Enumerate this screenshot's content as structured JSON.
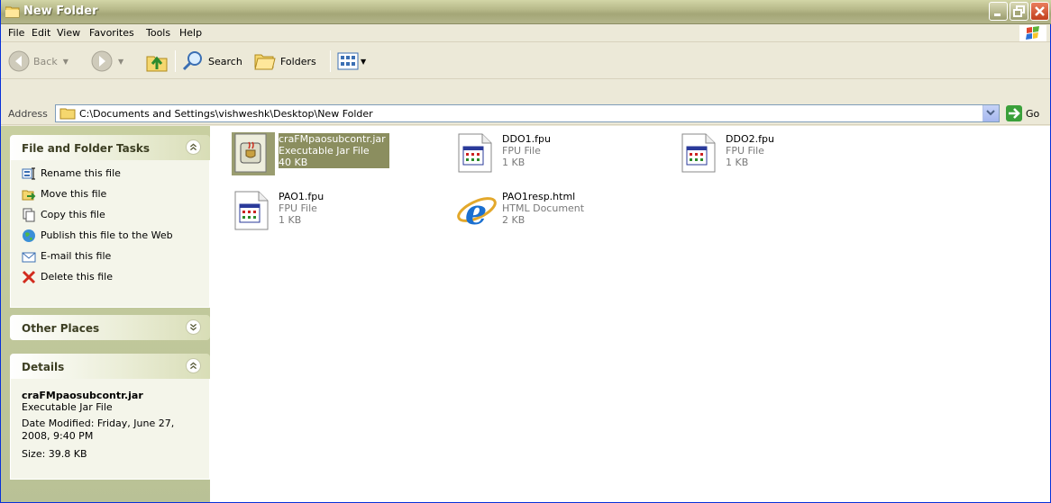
{
  "window": {
    "title": "New Folder"
  },
  "menu": [
    "File",
    "Edit",
    "View",
    "Favorites",
    "Tools",
    "Help"
  ],
  "toolbar": {
    "back_label": "Back",
    "search_label": "Search",
    "folders_label": "Folders"
  },
  "address": {
    "label": "Address",
    "value": "C:\\Documents and Settings\\vishweshk\\Desktop\\New Folder",
    "go_label": "Go"
  },
  "taskpane": {
    "file_tasks": {
      "title": "File and Folder Tasks",
      "items": [
        {
          "label": "Rename this file",
          "icon": "rename-icon"
        },
        {
          "label": "Move this file",
          "icon": "move-icon"
        },
        {
          "label": "Copy this file",
          "icon": "copy-icon"
        },
        {
          "label": "Publish this file to the Web",
          "icon": "publish-web-icon"
        },
        {
          "label": "E-mail this file",
          "icon": "email-icon"
        },
        {
          "label": "Delete this file",
          "icon": "delete-icon"
        }
      ]
    },
    "other_places": {
      "title": "Other Places"
    },
    "details": {
      "title": "Details",
      "filename": "craFMpaosubcontr.jar",
      "filetype": "Executable Jar File",
      "modified": "Date Modified: Friday, June 27, 2008, 9:40 PM",
      "size": "Size: 39.8 KB"
    }
  },
  "files": [
    {
      "name": "craFMpaosubcontr.jar",
      "type": "Executable Jar File",
      "size": "40 KB",
      "icon": "jar-file-icon",
      "selected": true
    },
    {
      "name": "DDO1.fpu",
      "type": "FPU File",
      "size": "1 KB",
      "icon": "fpu-file-icon"
    },
    {
      "name": "DDO2.fpu",
      "type": "FPU File",
      "size": "1 KB",
      "icon": "fpu-file-icon"
    },
    {
      "name": "PAO1.fpu",
      "type": "FPU File",
      "size": "1 KB",
      "icon": "fpu-file-icon"
    },
    {
      "name": "PAO1resp.html",
      "type": "HTML Document",
      "size": "2 KB",
      "icon": "ie-html-icon"
    }
  ],
  "colors": {
    "titlebar": "#b3b58a",
    "taskpane_bg": "#c8cfa0",
    "selection": "#8b8e5f",
    "close_button": "#c2401d"
  }
}
